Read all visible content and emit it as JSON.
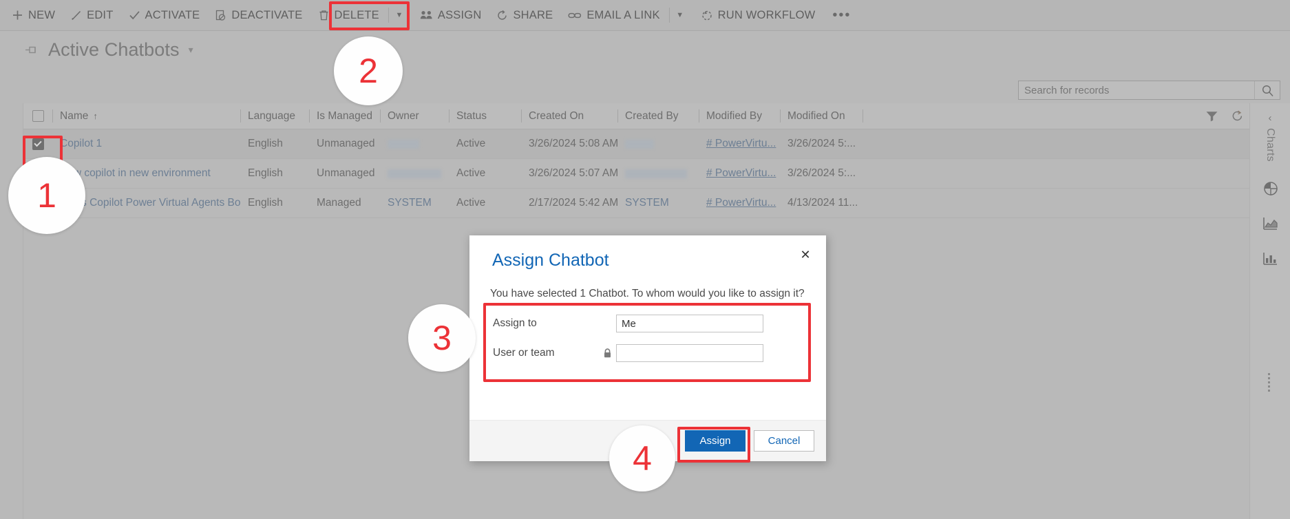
{
  "commandbar": {
    "items": [
      {
        "label": "NEW",
        "icon": "plus-icon"
      },
      {
        "label": "EDIT",
        "icon": "pencil-icon"
      },
      {
        "label": "ACTIVATE",
        "icon": "check-icon"
      },
      {
        "label": "DEACTIVATE",
        "icon": "deactivate-icon"
      },
      {
        "label": "DELETE",
        "icon": "trash-icon"
      },
      {
        "label": "ASSIGN",
        "icon": "assign-people-icon"
      },
      {
        "label": "SHARE",
        "icon": "share-icon"
      },
      {
        "label": "EMAIL A LINK",
        "icon": "link-icon"
      },
      {
        "label": "RUN WORKFLOW",
        "icon": "workflow-icon"
      }
    ],
    "overflow_label": "•••"
  },
  "view": {
    "title": "Active Chatbots",
    "pin_icon": "pin-icon",
    "caret_icon": "chevron-down-icon"
  },
  "search": {
    "placeholder": "Search for records",
    "value": "",
    "icon": "search-icon"
  },
  "grid": {
    "tools": [
      {
        "name": "filter-icon"
      },
      {
        "name": "refresh-icon"
      }
    ],
    "columns": [
      {
        "key": "check",
        "label": "",
        "sort": ""
      },
      {
        "key": "name",
        "label": "Name",
        "sort": "↑"
      },
      {
        "key": "language",
        "label": "Language",
        "sort": ""
      },
      {
        "key": "is_managed",
        "label": "Is Managed",
        "sort": ""
      },
      {
        "key": "owner",
        "label": "Owner",
        "sort": ""
      },
      {
        "key": "status",
        "label": "Status",
        "sort": ""
      },
      {
        "key": "created_on",
        "label": "Created On",
        "sort": ""
      },
      {
        "key": "created_by",
        "label": "Created By",
        "sort": ""
      },
      {
        "key": "modified_by",
        "label": "Modified By",
        "sort": ""
      },
      {
        "key": "modified_on",
        "label": "Modified On",
        "sort": ""
      }
    ],
    "rows": [
      {
        "selected": true,
        "name": "Copilot 1",
        "language": "English",
        "is_managed": "Unmanaged",
        "owner": "",
        "owner_redacted": true,
        "status": "Active",
        "created_on": "3/26/2024 5:08 AM",
        "created_by": "",
        "created_by_redacted": true,
        "modified_by": "# PowerVirtu...",
        "modified_on": "3/26/2024 5:..."
      },
      {
        "selected": false,
        "name": "New copilot in new environment",
        "language": "English",
        "is_managed": "Unmanaged",
        "owner": "",
        "owner_redacted": true,
        "status": "Active",
        "created_on": "3/26/2024 5:07 AM",
        "created_by": "",
        "created_by_redacted": true,
        "modified_by": "# PowerVirtu...",
        "modified_on": "3/26/2024 5:..."
      },
      {
        "selected": false,
        "name": "Sales Copilot Power Virtual Agents Bot",
        "language": "English",
        "is_managed": "Managed",
        "owner": "SYSTEM",
        "owner_redacted": false,
        "status": "Active",
        "created_on": "2/17/2024 5:42 AM",
        "created_by": "SYSTEM",
        "created_by_redacted": false,
        "modified_by": "# PowerVirtu...",
        "modified_on": "4/13/2024 11..."
      }
    ]
  },
  "right_panel": {
    "collapse_icon": "chevron-left-icon",
    "title": "Charts",
    "icons": [
      {
        "name": "pie-chart-icon"
      },
      {
        "name": "area-chart-icon"
      },
      {
        "name": "bar-chart-icon"
      }
    ],
    "handle_icon": "drag-handle-icon"
  },
  "modal": {
    "title": "Assign Chatbot",
    "close_icon": "close-icon",
    "subtitle": "You have selected 1 Chatbot. To whom would you like to assign it?",
    "fields": [
      {
        "label": "Assign to",
        "value": "Me",
        "locked": false
      },
      {
        "label": "User or team",
        "value": "",
        "locked": true,
        "lock_icon": "lock-icon"
      }
    ],
    "assign_label": "Assign",
    "cancel_label": "Cancel"
  },
  "steps": [
    {
      "n": "1"
    },
    {
      "n": "2"
    },
    {
      "n": "3"
    },
    {
      "n": "4"
    }
  ],
  "colors": {
    "annotation": "#ec3237",
    "primary": "#1266b5",
    "link": "#6d7f94"
  }
}
